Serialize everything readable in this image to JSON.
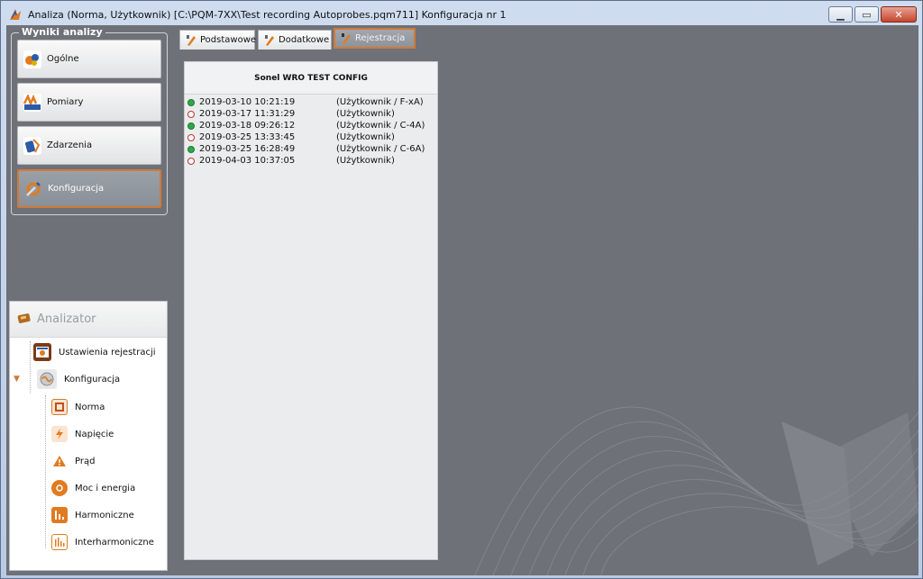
{
  "window": {
    "title": "Analiza (Norma, Użytkownik) [C:\\PQM-7XX\\Test recording Autoprobes.pqm711] Konfiguracja nr 1",
    "minimize": "▁",
    "restore": "▭",
    "close": "✕"
  },
  "results": {
    "legend": "Wyniki analizy",
    "items": [
      {
        "label": "Ogólne",
        "icon": "general-icon"
      },
      {
        "label": "Pomiary",
        "icon": "measurements-icon"
      },
      {
        "label": "Zdarzenia",
        "icon": "events-icon"
      },
      {
        "label": "Konfiguracja",
        "icon": "configuration-icon",
        "active": true
      }
    ]
  },
  "analyzer": {
    "title": "Analizator",
    "tree": [
      {
        "label": "Ustawienia rejestracji",
        "icon": "recording-settings-icon",
        "level": 0
      },
      {
        "label": "Konfiguracja",
        "icon": "configuration-icon",
        "level": 0,
        "expanded": true
      },
      {
        "label": "Norma",
        "icon": "norm-icon",
        "level": 1
      },
      {
        "label": "Napięcie",
        "icon": "voltage-icon",
        "level": 1
      },
      {
        "label": "Prąd",
        "icon": "current-icon",
        "level": 1
      },
      {
        "label": "Moc i energia",
        "icon": "power-energy-icon",
        "level": 1
      },
      {
        "label": "Harmoniczne",
        "icon": "harmonics-icon",
        "level": 1
      },
      {
        "label": "Interharmoniczne",
        "icon": "interharmonics-icon",
        "level": 1
      }
    ]
  },
  "tabs": [
    {
      "label": "Podstawowe",
      "active": false
    },
    {
      "label": "Dodatkowe",
      "active": false
    },
    {
      "label": "Rejestracja",
      "active": true
    }
  ],
  "config_panel": {
    "title": "Sonel WRO TEST CONFIG",
    "entries": [
      {
        "status": "start",
        "timestamp": "2019-03-10 10:21:19",
        "info": "(Użytkownik / F-xA)"
      },
      {
        "status": "stop",
        "timestamp": "2019-03-17 11:31:29",
        "info": "(Użytkownik)"
      },
      {
        "status": "start",
        "timestamp": "2019-03-18 09:26:12",
        "info": "(Użytkownik / C-4A)"
      },
      {
        "status": "stop",
        "timestamp": "2019-03-25 13:33:45",
        "info": "(Użytkownik)"
      },
      {
        "status": "start",
        "timestamp": "2019-03-25 16:28:49",
        "info": "(Użytkownik / C-6A)"
      },
      {
        "status": "stop",
        "timestamp": "2019-04-03 10:37:05",
        "info": "(Użytkownik)"
      }
    ]
  },
  "colors": {
    "accent": "#d07a38",
    "client_bg": "#6e7178",
    "status_on": "#2ea84a",
    "status_off": "#c03030"
  }
}
